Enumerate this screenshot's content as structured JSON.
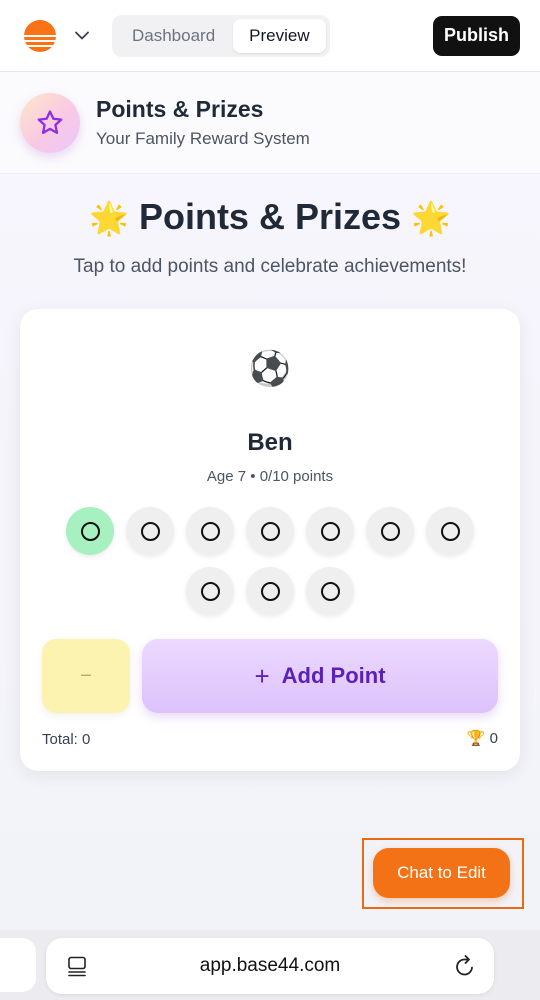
{
  "topbar": {
    "tabs": [
      {
        "label": "Dashboard",
        "active": false
      },
      {
        "label": "Preview",
        "active": true
      }
    ],
    "publish_label": "Publish",
    "logo_icon": "sunset-logo-icon",
    "brand_color": "#f97316"
  },
  "app_header": {
    "title": "Points & Prizes",
    "subtitle": "Your Family Reward System",
    "icon": "star-icon"
  },
  "hero": {
    "emoji_left": "🌟",
    "title": "Points & Prizes",
    "emoji_right": "🌟",
    "subtitle": "Tap to add points and celebrate achievements!"
  },
  "kid_card": {
    "avatar": "⚽",
    "name": "Ben",
    "meta": "Age 7 • 0/10 points",
    "points_earned": 0,
    "points_goal": 10,
    "minus_label": "−",
    "add_plus": "+",
    "add_label": "Add Point",
    "total_label": "Total: 0",
    "trophy": "🏆",
    "trophy_count": "0"
  },
  "chat_button": {
    "label": "Chat to Edit",
    "color": "#f47216"
  },
  "browser": {
    "url": "app.base44.com"
  }
}
